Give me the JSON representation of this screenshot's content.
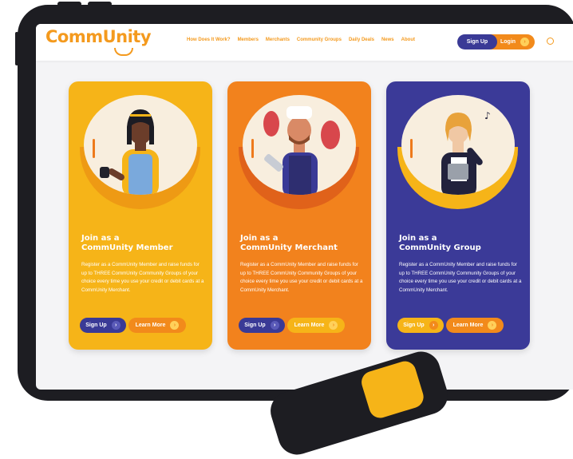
{
  "nav": {
    "logo": "CommUnity",
    "links": [
      "How Does It Work?",
      "Members",
      "Merchants",
      "Community Groups",
      "Daily Deals",
      "News",
      "About"
    ],
    "signup": "Sign Up",
    "login": "Login"
  },
  "cards": [
    {
      "title1": "Join as a",
      "title2": "CommUnity Member",
      "desc": "Register as a CommUnity Member and raise funds for up to THREE CommUnity Community Groups of your choice every time you use your credit or debit cards at a CommUnity Merchant.",
      "signup": "Sign Up",
      "learn": "Learn More"
    },
    {
      "title1": "Join as a",
      "title2": "CommUnity Merchant",
      "desc": "Register as a CommUnity Member and raise funds for up to THREE CommUnity Community Groups of your choice every time you use your credit or debit cards at a CommUnity Merchant.",
      "signup": "Sign Up",
      "learn": "Learn More"
    },
    {
      "title1": "Join as a",
      "title2": "CommUnity Group",
      "desc": "Register as a CommUnity Member and raise funds for up to THREE CommUnity Community Groups of your choice every time you use your credit or debit cards at a CommUnity Merchant.",
      "signup": "Sign Up",
      "learn": "Learn More"
    }
  ],
  "colors": {
    "member": "#f6b418",
    "merchant": "#f2821d",
    "group": "#3b3a98",
    "navy": "#3a3a96",
    "orange": "#f28a1b"
  },
  "icons": [
    "arrow-right-icon",
    "search-icon"
  ]
}
